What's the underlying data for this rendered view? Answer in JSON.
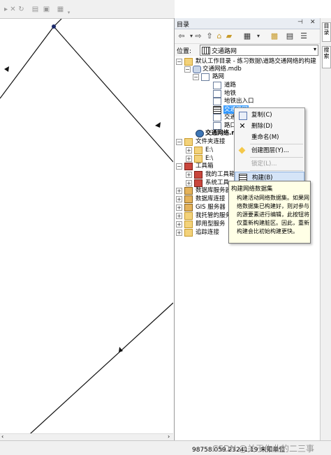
{
  "catalog": {
    "title": "目录",
    "location_label": "位置:",
    "location_value": "交通路网"
  },
  "tree": {
    "home": "默认工作目录 - 练习数据\\道路交通网络的构建",
    "mdb": "交通网络.mdb",
    "dataset": "路网",
    "fc_road": "道路",
    "fc_subway": "地铁",
    "fc_entrance": "地铁出入口",
    "fc_selected": "交通路网",
    "fc_junctions": "交通",
    "fc_crossing": "路口",
    "network_mdb": "交通网络.m",
    "folder_connections": "文件夹连接",
    "drive_e1": "E:\\",
    "drive_e2": "E:\\",
    "toolbox": "工具箱",
    "my_toolbox": "我的工具箱",
    "system_toolbox": "系统工具",
    "db_servers": "数据库服务器",
    "db_connections": "数据库连接",
    "gis_servers": "GIS 服务器",
    "hosted_services": "我托管的服务",
    "ready_services": "即用型服务",
    "tracking": "追踪连接"
  },
  "context_menu": {
    "copy": "复制(C)",
    "delete": "删除(D)",
    "rename": "重命名(M)",
    "create_layer": "创建图层(Y)...",
    "lock": "锁定(L)...",
    "build": "构建(B)"
  },
  "tooltip": {
    "title": "构建网络数据集",
    "body": "构建活动网络数据集。如果网络数据集已构建好，则对参与的源要素进行编辑，此按钮将仅重新构建脏区。因此，重新构建会比初始构建更快。"
  },
  "side_tabs": {
    "tab1": "目录",
    "tab2": "搜索"
  },
  "status": {
    "coords": "98758.059  23241.19 未知单位",
    "watermark": "CSDN @关于作业的二三事"
  },
  "colors": {
    "selection": "#3399ff",
    "menu_highlight": "#d5e4f7",
    "tooltip_bg": "#ffffe6"
  }
}
